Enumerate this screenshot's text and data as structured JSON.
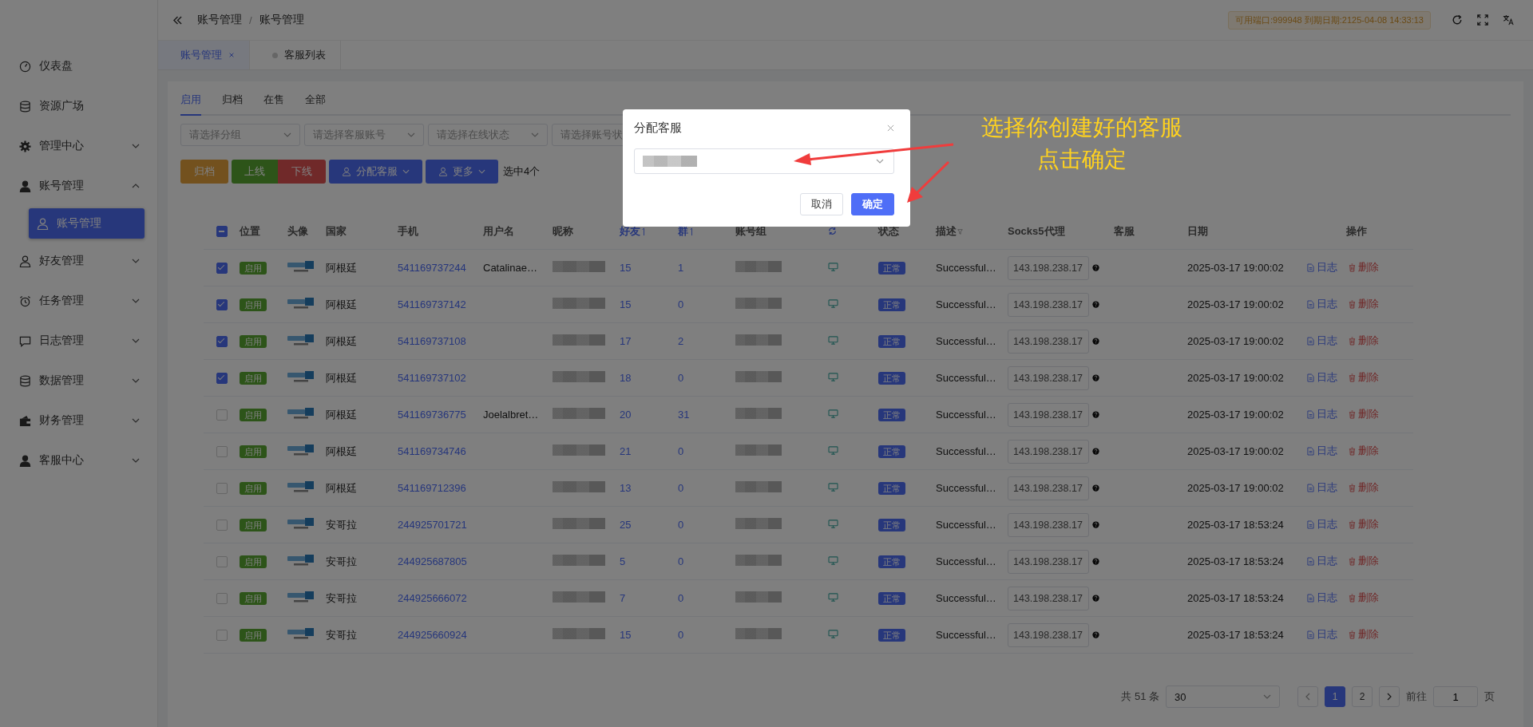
{
  "breadcrumb": [
    "账号管理",
    "账号管理"
  ],
  "breadcrumb_separator": "/",
  "status_badge": "可用端口:999948 到期日期:2125-04-08 14:33:13",
  "sidebar": {
    "items": [
      {
        "label": "仪表盘",
        "kind": "link"
      },
      {
        "label": "资源广场",
        "kind": "link"
      },
      {
        "label": "管理中心",
        "kind": "group",
        "expanded": false
      },
      {
        "label": "账号管理",
        "kind": "group",
        "expanded": true,
        "children": [
          {
            "label": "账号管理",
            "selected": true
          }
        ]
      },
      {
        "label": "好友管理",
        "kind": "group",
        "expanded": false
      },
      {
        "label": "任务管理",
        "kind": "group",
        "expanded": false
      },
      {
        "label": "日志管理",
        "kind": "group",
        "expanded": false
      },
      {
        "label": "数据管理",
        "kind": "group",
        "expanded": false
      },
      {
        "label": "财务管理",
        "kind": "group",
        "expanded": false
      },
      {
        "label": "客服中心",
        "kind": "group",
        "expanded": false
      }
    ]
  },
  "page_tabs": [
    {
      "label": "账号管理",
      "selected": true,
      "closable": true
    },
    {
      "label": "客服列表",
      "selected": false,
      "closable": false
    }
  ],
  "tabs": [
    {
      "label": "启用",
      "selected": true
    },
    {
      "label": "归档",
      "selected": false
    },
    {
      "label": "在售",
      "selected": false
    },
    {
      "label": "全部",
      "selected": false
    }
  ],
  "filters": [
    {
      "placeholder": "请选择分组"
    },
    {
      "placeholder": "请选择客服账号"
    },
    {
      "placeholder": "请选择在线状态"
    },
    {
      "placeholder": "请选择账号状"
    }
  ],
  "toolbar": {
    "buttons": [
      {
        "label": "归档",
        "kind": "archive"
      },
      {
        "label": "上线",
        "kind": "online"
      },
      {
        "label": "下线",
        "kind": "offline"
      },
      {
        "label": "分配客服",
        "kind": "dropdown"
      },
      {
        "label": "更多",
        "kind": "dropdown"
      }
    ],
    "selection": "选中4个"
  },
  "table": {
    "header_checkbox": {
      "indeterminate": true
    },
    "columns": [
      {
        "label": "位置",
        "kind": "plain"
      },
      {
        "label": "头像",
        "kind": "plain"
      },
      {
        "label": "国家",
        "kind": "plain"
      },
      {
        "label": "手机",
        "kind": "plain"
      },
      {
        "label": "用户名",
        "kind": "plain"
      },
      {
        "label": "昵称",
        "kind": "plain"
      },
      {
        "label": "好友",
        "kind": "sort"
      },
      {
        "label": "群",
        "kind": "sort"
      },
      {
        "label": "账号组",
        "kind": "plain"
      },
      {
        "kind": "refresh"
      },
      {
        "label": "状态",
        "kind": "plain"
      },
      {
        "label": "描述",
        "kind": "filter"
      },
      {
        "label": "Socks5代理",
        "kind": "plain"
      },
      {
        "label": "客服",
        "kind": "plain"
      },
      {
        "label": "日期",
        "kind": "plain"
      },
      {
        "label": "操作",
        "kind": "center"
      }
    ],
    "rows": [
      {
        "checked": true,
        "position": "启用",
        "country": "阿根廷",
        "phone": "541169737244",
        "username": "Catalinae…",
        "friends": "15",
        "groups": "1",
        "status": "正常",
        "description": "Successful…",
        "proxy": "143.198.238.17",
        "date": "2025-03-17 19:00:02",
        "actions": [
          "日志",
          "删除"
        ]
      },
      {
        "checked": true,
        "position": "启用",
        "country": "阿根廷",
        "phone": "541169737142",
        "friends": "15",
        "groups": "0",
        "status": "正常",
        "description": "Successful…",
        "proxy": "143.198.238.17",
        "date": "2025-03-17 19:00:02",
        "actions": [
          "日志",
          "删除"
        ]
      },
      {
        "checked": true,
        "position": "启用",
        "country": "阿根廷",
        "phone": "541169737108",
        "friends": "17",
        "groups": "2",
        "status": "正常",
        "description": "Successful…",
        "proxy": "143.198.238.17",
        "date": "2025-03-17 19:00:02",
        "actions": [
          "日志",
          "删除"
        ]
      },
      {
        "checked": true,
        "position": "启用",
        "country": "阿根廷",
        "phone": "541169737102",
        "friends": "18",
        "groups": "0",
        "status": "正常",
        "description": "Successful…",
        "proxy": "143.198.238.17",
        "date": "2025-03-17 19:00:02",
        "actions": [
          "日志",
          "删除"
        ]
      },
      {
        "checked": false,
        "position": "启用",
        "country": "阿根廷",
        "phone": "541169736775",
        "username": "Joelalbret…",
        "friends": "20",
        "groups": "31",
        "status": "正常",
        "description": "Successful…",
        "proxy": "143.198.238.17",
        "date": "2025-03-17 19:00:02",
        "actions": [
          "日志",
          "删除"
        ]
      },
      {
        "checked": false,
        "position": "启用",
        "country": "阿根廷",
        "phone": "541169734746",
        "friends": "21",
        "groups": "0",
        "status": "正常",
        "description": "Successful…",
        "proxy": "143.198.238.17",
        "date": "2025-03-17 19:00:02",
        "actions": [
          "日志",
          "删除"
        ]
      },
      {
        "checked": false,
        "position": "启用",
        "country": "阿根廷",
        "phone": "541169712396",
        "friends": "13",
        "groups": "0",
        "status": "正常",
        "description": "Successful…",
        "proxy": "143.198.238.17",
        "date": "2025-03-17 19:00:02",
        "actions": [
          "日志",
          "删除"
        ]
      },
      {
        "checked": false,
        "position": "启用",
        "country": "安哥拉",
        "phone": "244925701721",
        "friends": "25",
        "groups": "0",
        "status": "正常",
        "description": "Successful…",
        "proxy": "143.198.238.17",
        "date": "2025-03-17 18:53:24",
        "actions": [
          "日志",
          "删除"
        ]
      },
      {
        "checked": false,
        "position": "启用",
        "country": "安哥拉",
        "phone": "244925687805",
        "friends": "5",
        "groups": "0",
        "status": "正常",
        "description": "Successful…",
        "proxy": "143.198.238.17",
        "date": "2025-03-17 18:53:24",
        "actions": [
          "日志",
          "删除"
        ]
      },
      {
        "checked": false,
        "position": "启用",
        "country": "安哥拉",
        "phone": "244925666072",
        "friends": "7",
        "groups": "0",
        "status": "正常",
        "description": "Successful…",
        "proxy": "143.198.238.17",
        "date": "2025-03-17 18:53:24",
        "actions": [
          "日志",
          "删除"
        ]
      },
      {
        "checked": false,
        "position": "启用",
        "country": "安哥拉",
        "phone": "244925660924",
        "friends": "15",
        "groups": "0",
        "status": "正常",
        "description": "Successful…",
        "proxy": "143.198.238.17",
        "date": "2025-03-17 18:53:24",
        "actions": [
          "日志",
          "删除"
        ]
      }
    ]
  },
  "pagination": {
    "total": "共 51 条",
    "page_size": "30",
    "pages": [
      {
        "label": "1",
        "selected": true
      },
      {
        "label": "2",
        "selected": false
      }
    ],
    "goto_label": "前往",
    "goto_value": "1",
    "goto_suffix": "页"
  },
  "dialog": {
    "title": "分配客服",
    "buttons": [
      {
        "label": "取消",
        "kind": "secondary"
      },
      {
        "label": "确定",
        "kind": "primary"
      }
    ]
  },
  "annotation": {
    "lines": [
      "选择你创建好的客服",
      "点击确定"
    ]
  }
}
